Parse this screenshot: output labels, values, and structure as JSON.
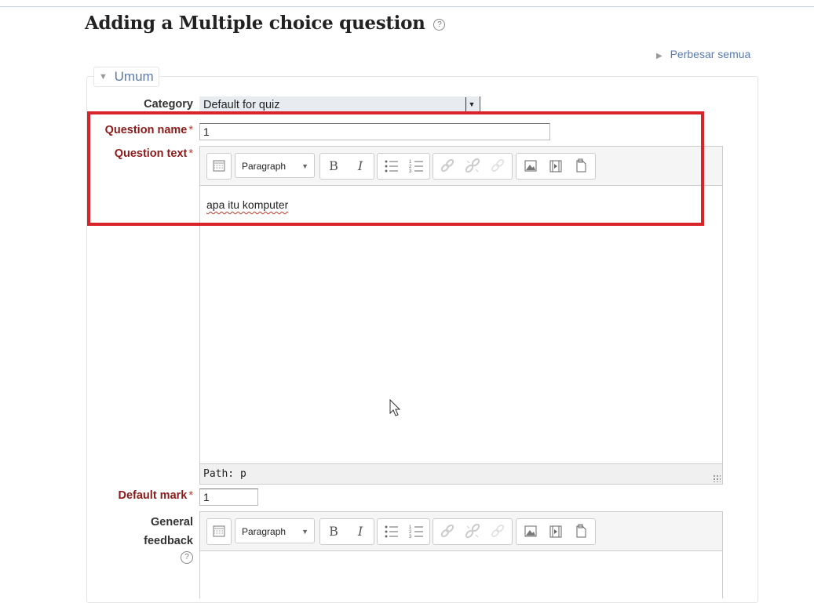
{
  "page": {
    "title": "Adding a Multiple choice question",
    "help_glyph": "?"
  },
  "expand_all": {
    "label": "Perbesar semua",
    "icon": "triangle-right-icon"
  },
  "section": {
    "legend": "Umum",
    "icon": "triangle-down-icon"
  },
  "fields": {
    "category": {
      "label": "Category",
      "value": "Default for quiz"
    },
    "question_name": {
      "label": "Question name",
      "required_mark": "*",
      "value": "1"
    },
    "question_text": {
      "label": "Question text",
      "required_mark": "*",
      "format": "Paragraph",
      "content": "apa itu komputer",
      "path": "Path: p"
    },
    "default_mark": {
      "label": "Default mark",
      "required_mark": "*",
      "value": "1"
    },
    "general_feedback": {
      "label_line1": "General",
      "label_line2": "feedback",
      "format": "Paragraph",
      "help_glyph": "?"
    }
  },
  "toolbar": {
    "bold": "B",
    "italic": "I",
    "icons": [
      "toggle-toolbar-icon",
      "bold-icon",
      "italic-icon",
      "bullet-list-icon",
      "numbered-list-icon",
      "link-icon",
      "unlink-icon",
      "anchor-icon",
      "image-icon",
      "media-icon",
      "manage-files-icon"
    ]
  },
  "colors": {
    "required": "#8b1a1a",
    "highlight": "#d8232a",
    "link": "#5a7ab0"
  }
}
